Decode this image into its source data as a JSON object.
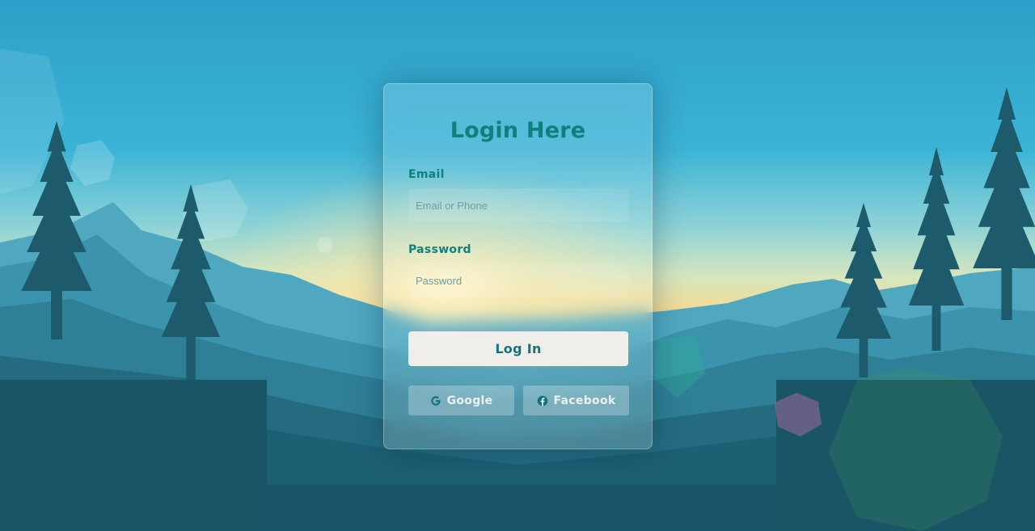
{
  "form": {
    "title": "Login Here",
    "email_label": "Email",
    "email_placeholder": "Email or Phone",
    "email_value": "",
    "password_label": "Password",
    "password_placeholder": "Password",
    "password_value": "",
    "login_label": "Log In",
    "google_label": "Google",
    "google_icon": "google-icon",
    "facebook_label": "Facebook",
    "facebook_icon": "facebook-icon"
  },
  "colors": {
    "accent": "#0f807e",
    "button_bg": "#efeeea"
  }
}
